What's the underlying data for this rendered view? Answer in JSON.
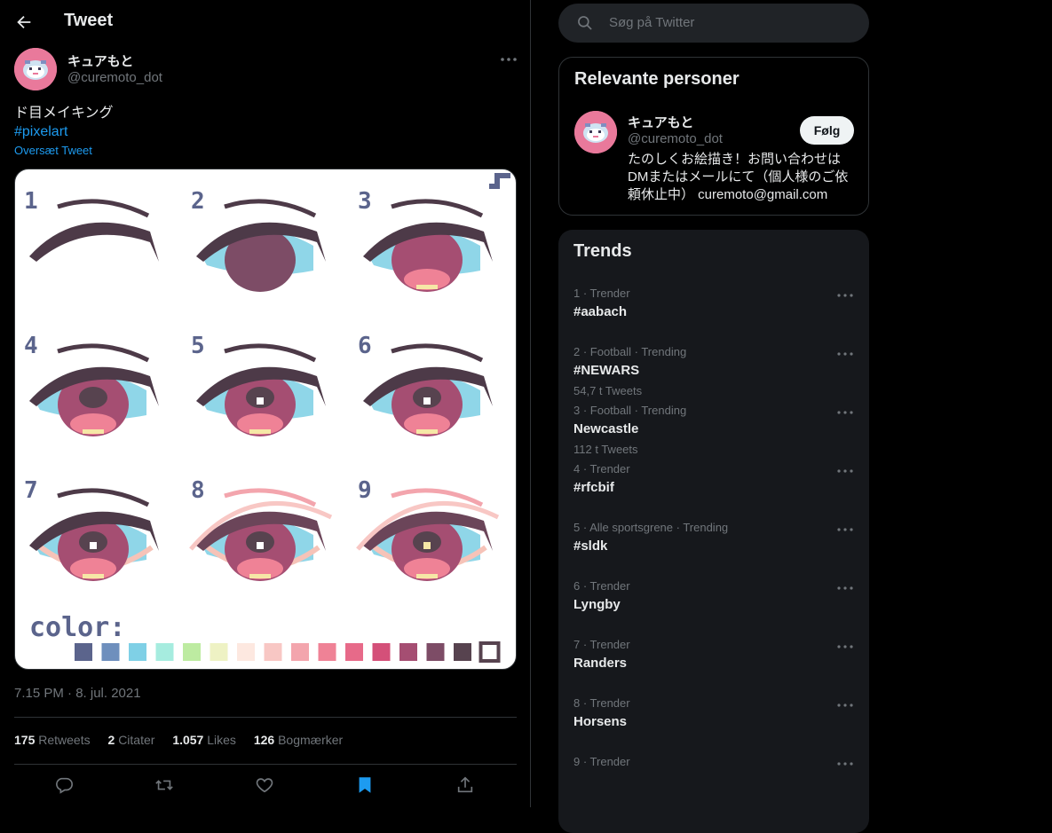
{
  "header": {
    "title": "Tweet"
  },
  "tweet": {
    "author_name": "キュアもと",
    "author_handle": "@curemoto_dot",
    "text": "ド目メイキング",
    "hashtag": "#pixelart",
    "translate_label": "Oversæt Tweet",
    "media": {
      "step_labels": [
        "1",
        "2",
        "3",
        "4",
        "5",
        "6",
        "7",
        "8",
        "9"
      ],
      "color_label": "color:",
      "palette": [
        "#5b648c",
        "#6e8fbd",
        "#7fd0e6",
        "#a6ecdf",
        "#bdeba1",
        "#eef2c4",
        "#fde8e0",
        "#f8c7c4",
        "#f3a5ad",
        "#ef8296",
        "#e76a89",
        "#d45079",
        "#a54e72",
        "#7d4c66",
        "#57434f",
        "#ffffff"
      ]
    },
    "timestamp": "7.15 PM · 8. jul. 2021",
    "stats": {
      "retweets_count": "175",
      "retweets_label": "Retweets",
      "quotes_count": "2",
      "quotes_label": "Citater",
      "likes_count": "1.057",
      "likes_label": "Likes",
      "bookmarks_count": "126",
      "bookmarks_label": "Bogmærker"
    }
  },
  "sidebar": {
    "search_placeholder": "Søg på Twitter",
    "relevant": {
      "title": "Relevante personer",
      "name": "キュアもと",
      "handle": "@curemoto_dot",
      "follow_label": "Følg",
      "bio": "たのしくお絵描き！お問い合わせはDMまたはメールにて（個人様のご依頼休止中） curemoto@gmail.com"
    },
    "trends": {
      "title": "Trends",
      "items": [
        {
          "meta": "1 · Trender",
          "name": "#aabach",
          "count": ""
        },
        {
          "meta": "2 · Football · Trending",
          "name": "#NEWARS",
          "count": "54,7 t Tweets"
        },
        {
          "meta": "3 · Football · Trending",
          "name": "Newcastle",
          "count": "112 t Tweets"
        },
        {
          "meta": "4 · Trender",
          "name": "#rfcbif",
          "count": ""
        },
        {
          "meta": "5 · Alle sportsgrene · Trending",
          "name": "#sldk",
          "count": ""
        },
        {
          "meta": "6 · Trender",
          "name": "Lyngby",
          "count": ""
        },
        {
          "meta": "7 · Trender",
          "name": "Randers",
          "count": ""
        },
        {
          "meta": "8 · Trender",
          "name": "Horsens",
          "count": ""
        },
        {
          "meta": "9 · Trender",
          "name": "",
          "count": ""
        }
      ]
    }
  },
  "colors": {
    "accent": "#1d9bf0",
    "bookmark_active": "#1d9bf0",
    "avatar_bg": "#e9799b"
  }
}
